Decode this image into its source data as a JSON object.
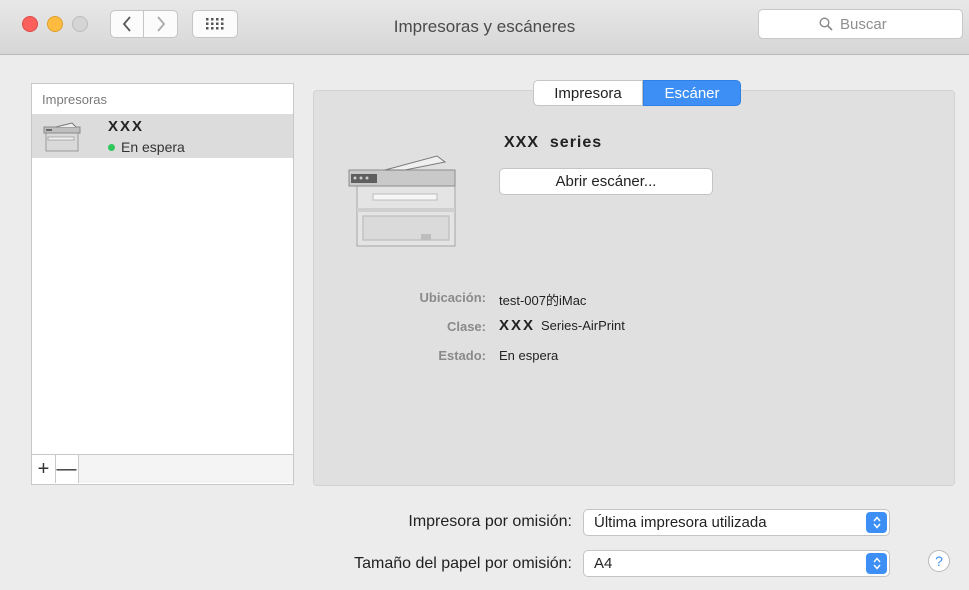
{
  "window": {
    "title": "Impresoras y escáneres"
  },
  "toolbar": {
    "search_placeholder": "Buscar"
  },
  "printer_list": {
    "header": "Impresoras",
    "items": [
      {
        "name": "XXX",
        "status": "En espera"
      }
    ],
    "add_label": "+",
    "remove_label": "—"
  },
  "tabs": [
    {
      "label": "Impresora",
      "selected": false
    },
    {
      "label": "Escáner",
      "selected": true
    }
  ],
  "device": {
    "series_mark": "XXX",
    "series_suffix": "series",
    "open_scanner_label": "Abrir escáner..."
  },
  "info": {
    "location_label": "Ubicación:",
    "location_value": "test-007的iMac",
    "class_label": "Clase:",
    "class_mark": "XXX",
    "class_value": "Series-AirPrint",
    "status_label": "Estado:",
    "status_value": "En espera"
  },
  "defaults": {
    "printer_label": "Impresora por omisión:",
    "printer_value": "Última impresora utilizada",
    "paper_label": "Tamaño del papel por omisión:",
    "paper_value": "A4"
  },
  "help_label": "?",
  "colors": {
    "accent": "#3d8ff5",
    "status_ok": "#2fc65c"
  }
}
